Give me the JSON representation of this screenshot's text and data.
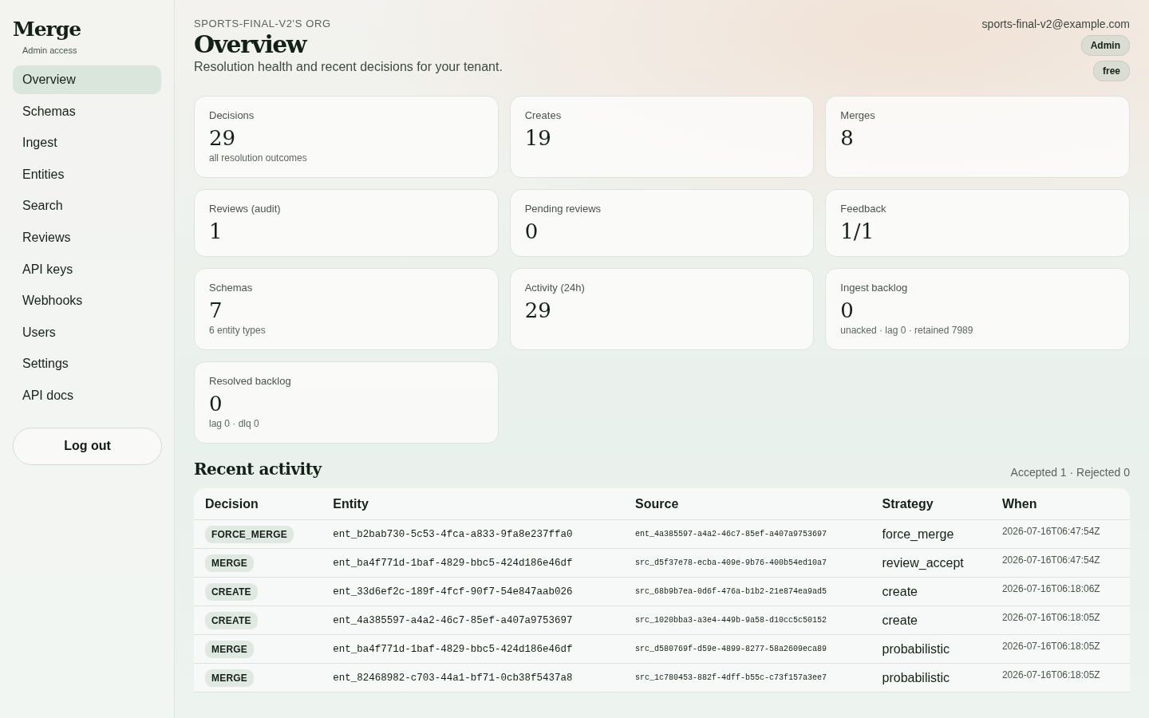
{
  "sidebar": {
    "brand": "Merge",
    "subtitle": "Admin access",
    "items": [
      {
        "label": "Overview",
        "selected": true
      },
      {
        "label": "Schemas",
        "selected": false
      },
      {
        "label": "Ingest",
        "selected": false
      },
      {
        "label": "Entities",
        "selected": false
      },
      {
        "label": "Search",
        "selected": false
      },
      {
        "label": "Reviews",
        "selected": false
      },
      {
        "label": "API keys",
        "selected": false
      },
      {
        "label": "Webhooks",
        "selected": false
      },
      {
        "label": "Users",
        "selected": false
      },
      {
        "label": "Settings",
        "selected": false
      },
      {
        "label": "API docs",
        "selected": false
      }
    ],
    "logout": "Log out"
  },
  "header": {
    "org": "SPORTS-FINAL-V2'S ORG",
    "title": "Overview",
    "subtitle": "Resolution health and recent decisions for your tenant.",
    "email": "sports-final-v2@example.com",
    "badges": [
      "Admin",
      "free"
    ]
  },
  "stats": [
    {
      "label": "Decisions",
      "value": "29",
      "note": "all resolution outcomes"
    },
    {
      "label": "Creates",
      "value": "19"
    },
    {
      "label": "Merges",
      "value": "8"
    },
    {
      "label": "Reviews (audit)",
      "value": "1"
    },
    {
      "label": "Pending reviews",
      "value": "0"
    },
    {
      "label": "Feedback",
      "value": "1/1"
    },
    {
      "label": "Schemas",
      "value": "7",
      "note": "6 entity types"
    },
    {
      "label": "Activity (24h)",
      "value": "29"
    },
    {
      "label": "Ingest backlog",
      "value": "0",
      "note": "unacked · lag 0 · retained 7989"
    },
    {
      "label": "Resolved backlog",
      "value": "0",
      "note": "lag 0 · dlq 0"
    }
  ],
  "recent_activity": {
    "title": "Recent activity",
    "summary": "Accepted 1 · Rejected 0",
    "columns": [
      "Decision",
      "Entity",
      "Source",
      "Strategy",
      "When"
    ],
    "rows": [
      {
        "decision": "FORCE_MERGE",
        "entity": "ent_b2bab730-5c53-4fca-a833-9fa8e237ffa0",
        "source": "ent_4a385597-a4a2-46c7-85ef-a407a9753697",
        "strategy": "force_merge",
        "when": "2026-07-16T06:47:54Z"
      },
      {
        "decision": "MERGE",
        "entity": "ent_ba4f771d-1baf-4829-bbc5-424d186e46df",
        "source": "src_d5f37e78-ecba-409e-9b76-400b54ed10a7",
        "strategy": "review_accept",
        "when": "2026-07-16T06:47:54Z"
      },
      {
        "decision": "CREATE",
        "entity": "ent_33d6ef2c-189f-4fcf-90f7-54e847aab026",
        "source": "src_68b9b7ea-0d6f-476a-b1b2-21e874ea9ad5",
        "strategy": "create",
        "when": "2026-07-16T06:18:06Z"
      },
      {
        "decision": "CREATE",
        "entity": "ent_4a385597-a4a2-46c7-85ef-a407a9753697",
        "source": "src_1020bba3-a3e4-449b-9a58-d10cc5c50152",
        "strategy": "create",
        "when": "2026-07-16T06:18:05Z"
      },
      {
        "decision": "MERGE",
        "entity": "ent_ba4f771d-1baf-4829-bbc5-424d186e46df",
        "source": "src_d580769f-d59e-4899-8277-58a2609eca89",
        "strategy": "probabilistic",
        "when": "2026-07-16T06:18:05Z"
      },
      {
        "decision": "MERGE",
        "entity": "ent_82468982-c703-44a1-bf71-0cb38f5437a8",
        "source": "src_1c780453-882f-4dff-b55c-c73f157a3ee7",
        "strategy": "probabilistic",
        "when": "2026-07-16T06:18:05Z"
      }
    ]
  }
}
